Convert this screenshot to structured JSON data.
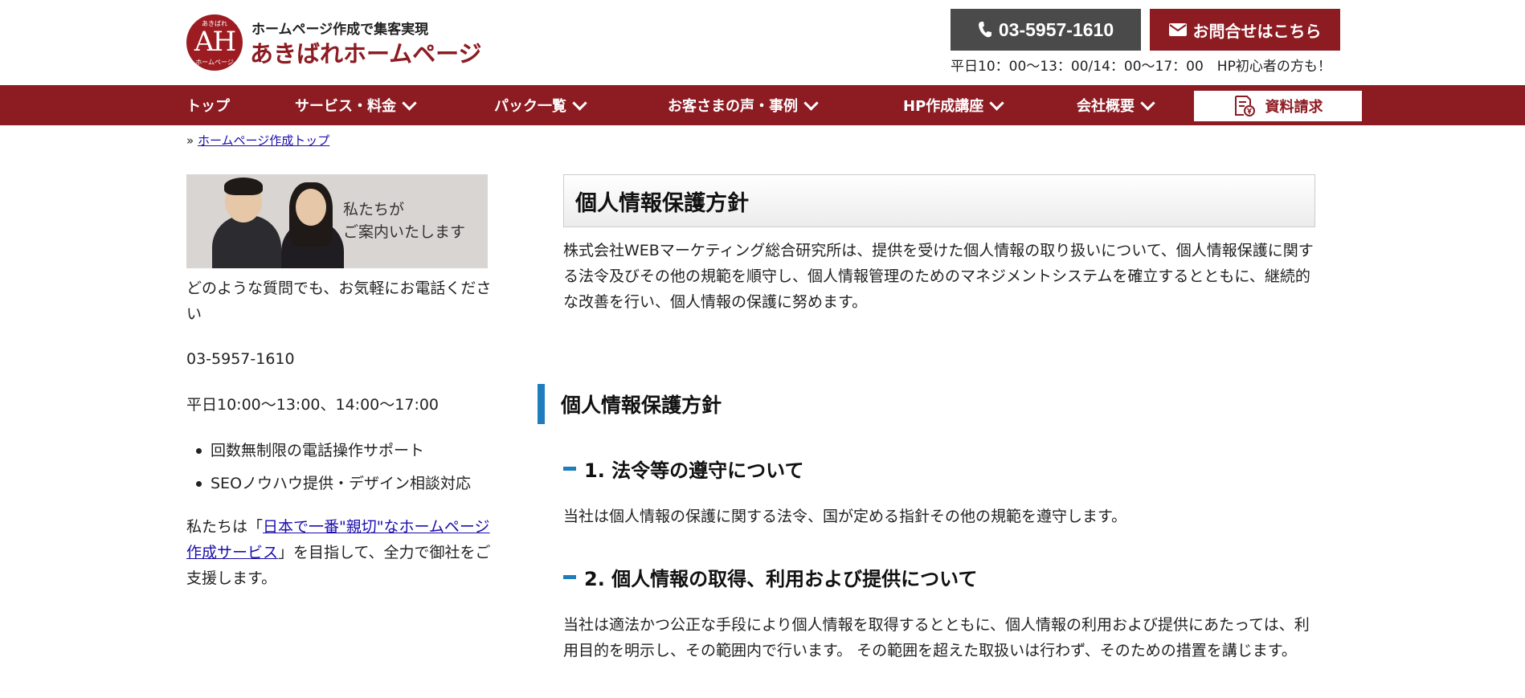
{
  "header": {
    "logo_mark_top": "あきばれ",
    "logo_mark_letters": "AH",
    "logo_mark_bottom": "ホームページ",
    "tagline": "ホームページ作成で集客実現",
    "brand": "あきばれホームページ",
    "tel_button": "03-5957-1610",
    "contact_button": "お問合せはこちら",
    "hours": "平日10：00〜13：00/14：00〜17：00　HP初心者の方も！",
    "colors": {
      "brand": "#8d1b22",
      "tel_button": "#4a4a4a"
    }
  },
  "nav": {
    "items": [
      {
        "label": "トップ"
      },
      {
        "label": "サービス・料金"
      },
      {
        "label": "パック一覧"
      },
      {
        "label": "お客さまの声・事例"
      },
      {
        "label": "HP作成講座"
      },
      {
        "label": "会社概要"
      }
    ],
    "cta": "資料請求",
    "icons": {
      "dropdown": "chevron-down-icon",
      "cta": "document-yen-icon"
    }
  },
  "breadcrumb": {
    "prefix": "»",
    "link": "ホームページ作成トップ"
  },
  "sidebar": {
    "banner_line1": "私たちが",
    "banner_line2": "ご案内いたします",
    "intro": "どのような質問でも、お気軽にお電話ください",
    "phone": "03-5957-1610",
    "hours": "平日10:00〜13:00、14:00〜17:00",
    "features": [
      "回数無制限の電話操作サポート",
      "SEOノウハウ提供・デザイン相談対応"
    ],
    "mission_pre": "私たちは「",
    "mission_link": "日本で一番\"親切\"なホームページ作成サービス",
    "mission_post": "」を目指して、全力で御社をご支援します。"
  },
  "main": {
    "title": "個人情報保護方針",
    "intro": "株式会社WEBマーケティング総合研究所は、提供を受けた個人情報の取り扱いについて、個人情報保護に関する法令及びその他の規範を順守し、個人情報管理のためのマネジメントシステムを確立するとともに、継続的な改善を行い、個人情報の保護に努めます。",
    "section_heading": "個人情報保護方針",
    "sections": [
      {
        "heading": "1. 法令等の遵守について",
        "body": "当社は個人情報の保護に関する法令、国が定める指針その他の規範を遵守します。"
      },
      {
        "heading": "2. 個人情報の取得、利用および提供について",
        "body": "当社は適法かつ公正な手段により個人情報を取得するとともに、個人情報の利用および提供にあたっては、利用目的を明示し、その範囲内で行います。 その範囲を超えた取扱いは行わず、そのための措置を講じます。"
      }
    ],
    "accent_color": "#1f7dbd"
  }
}
